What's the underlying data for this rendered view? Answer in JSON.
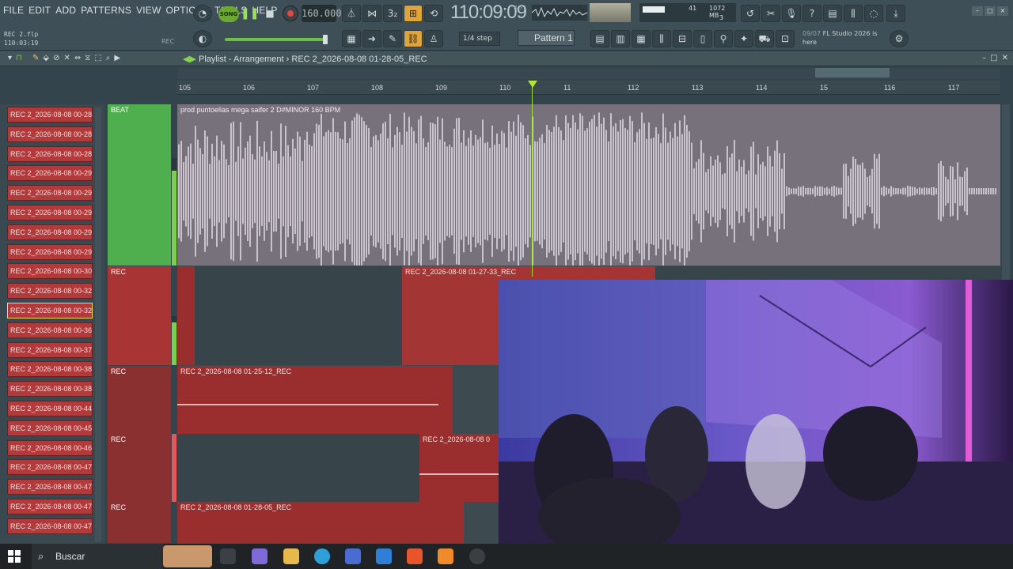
{
  "menu": [
    "FILE",
    "EDIT",
    "ADD",
    "PATTERNS",
    "VIEW",
    "OPTIONS",
    "TOOLS",
    "HELP"
  ],
  "project": {
    "file": "REC 2.flp",
    "time": "110:03:19",
    "rec_label": "REC"
  },
  "transport": {
    "song_label": "SONG",
    "tempo": "160.000",
    "time_display": "110:09:09",
    "time_sub": "8:57"
  },
  "cpu": {
    "value1": "41",
    "memory": "1072 MB",
    "voices": "3"
  },
  "snap": "1/4 step",
  "pattern": "Pattern 1",
  "news": {
    "date": "09/07",
    "text": "FL Studio 2026 is here"
  },
  "playlist": {
    "title": "Playlist - Arrangement",
    "breadcrumb": "REC 2_2026-08-08 01-28-05_REC"
  },
  "ruler_ticks": [
    "105",
    "106",
    "107",
    "108",
    "109",
    "110",
    "11",
    "112",
    "113",
    "114",
    "15",
    "116",
    "117"
  ],
  "picker_items": [
    "REC 2_2026-08-08 00-28...",
    "REC 2_2026-08-08 00-28...",
    "REC 2_2026-08-08 00-28...",
    "REC 2_2026-08-08 00-29...",
    "REC 2_2026-08-08 00-29...",
    "REC 2_2026-08-08 00-29...",
    "REC 2_2026-08-08 00-29...",
    "REC 2_2026-08-08 00-29...",
    "REC 2_2026-08-08 00-30...",
    "REC 2_2026-08-08 00-32...",
    "REC 2_2026-08-08 00-32...",
    "REC 2_2026-08-08 00-36...",
    "REC 2_2026-08-08 00-37...",
    "REC 2_2026-08-08 00-38...",
    "REC 2_2026-08-08 00-38...",
    "REC 2_2026-08-08 00-44...",
    "REC 2_2026-08-08 00-45...",
    "REC 2_2026-08-08 00-46...",
    "REC 2_2026-08-08 00-47...",
    "REC 2_2026-08-08 00-47...",
    "REC 2_2026-08-08 00-47...",
    "REC 2_2026-08-08 00-47..."
  ],
  "tracks": [
    {
      "name": "BEAT",
      "color": "#4faf4f"
    },
    {
      "name": "REC",
      "color": "#a83434"
    },
    {
      "name": "REC",
      "color": "#8a3030"
    },
    {
      "name": "REC",
      "color": "#8a3030"
    },
    {
      "name": "REC",
      "color": "#8a3030"
    }
  ],
  "clips": {
    "beat": "prod puntoelias mega saifer 2 D#MINOR 160 BPM",
    "rec_a": "REC 2_2026-08-08 01-27-33_REC",
    "rec_b": "REC 2_2026-08-08 01-25-12_REC",
    "rec_c": "REC 2_2026-08-08 0",
    "rec_d": "REC 2_2026-08-08 01-28-05_REC"
  },
  "taskbar": {
    "search": "Buscar"
  }
}
